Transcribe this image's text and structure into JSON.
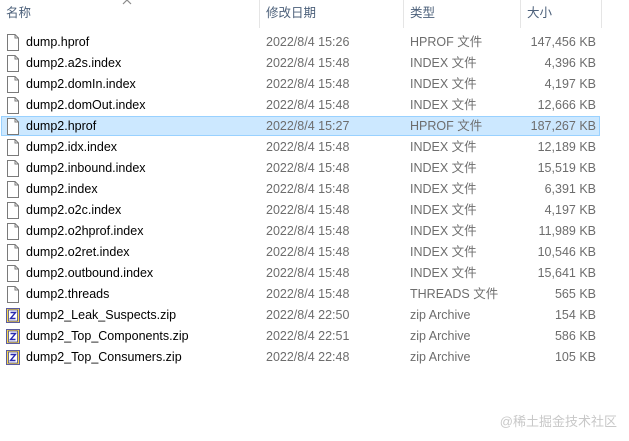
{
  "columns": {
    "name": "名称",
    "date": "修改日期",
    "type": "类型",
    "size": "大小"
  },
  "files": [
    {
      "name": "dump.hprof",
      "date": "2022/8/4 15:26",
      "type": "HPROF 文件",
      "size": "147,456 KB",
      "icon": "file-icon",
      "selected": false
    },
    {
      "name": "dump2.a2s.index",
      "date": "2022/8/4 15:48",
      "type": "INDEX 文件",
      "size": "4,396 KB",
      "icon": "file-icon",
      "selected": false
    },
    {
      "name": "dump2.domIn.index",
      "date": "2022/8/4 15:48",
      "type": "INDEX 文件",
      "size": "4,197 KB",
      "icon": "file-icon",
      "selected": false
    },
    {
      "name": "dump2.domOut.index",
      "date": "2022/8/4 15:48",
      "type": "INDEX 文件",
      "size": "12,666 KB",
      "icon": "file-icon",
      "selected": false
    },
    {
      "name": "dump2.hprof",
      "date": "2022/8/4 15:27",
      "type": "HPROF 文件",
      "size": "187,267 KB",
      "icon": "file-icon",
      "selected": true
    },
    {
      "name": "dump2.idx.index",
      "date": "2022/8/4 15:48",
      "type": "INDEX 文件",
      "size": "12,189 KB",
      "icon": "file-icon",
      "selected": false
    },
    {
      "name": "dump2.inbound.index",
      "date": "2022/8/4 15:48",
      "type": "INDEX 文件",
      "size": "15,519 KB",
      "icon": "file-icon",
      "selected": false
    },
    {
      "name": "dump2.index",
      "date": "2022/8/4 15:48",
      "type": "INDEX 文件",
      "size": "6,391 KB",
      "icon": "file-icon",
      "selected": false
    },
    {
      "name": "dump2.o2c.index",
      "date": "2022/8/4 15:48",
      "type": "INDEX 文件",
      "size": "4,197 KB",
      "icon": "file-icon",
      "selected": false
    },
    {
      "name": "dump2.o2hprof.index",
      "date": "2022/8/4 15:48",
      "type": "INDEX 文件",
      "size": "11,989 KB",
      "icon": "file-icon",
      "selected": false
    },
    {
      "name": "dump2.o2ret.index",
      "date": "2022/8/4 15:48",
      "type": "INDEX 文件",
      "size": "10,546 KB",
      "icon": "file-icon",
      "selected": false
    },
    {
      "name": "dump2.outbound.index",
      "date": "2022/8/4 15:48",
      "type": "INDEX 文件",
      "size": "15,641 KB",
      "icon": "file-icon",
      "selected": false
    },
    {
      "name": "dump2.threads",
      "date": "2022/8/4 15:48",
      "type": "THREADS 文件",
      "size": "565 KB",
      "icon": "file-icon",
      "selected": false
    },
    {
      "name": "dump2_Leak_Suspects.zip",
      "date": "2022/8/4 22:50",
      "type": "zip Archive",
      "size": "154 KB",
      "icon": "zip-archive-icon",
      "selected": false
    },
    {
      "name": "dump2_Top_Components.zip",
      "date": "2022/8/4 22:51",
      "type": "zip Archive",
      "size": "586 KB",
      "icon": "zip-archive-icon",
      "selected": false
    },
    {
      "name": "dump2_Top_Consumers.zip",
      "date": "2022/8/4 22:48",
      "type": "zip Archive",
      "size": "105 KB",
      "icon": "zip-archive-icon",
      "selected": false
    }
  ],
  "watermark": "@稀土掘金技术社区",
  "colors": {
    "selection_bg": "#cce8ff",
    "selection_border": "#99d1ff",
    "header_text": "#4c607a",
    "meta_text": "#6d6d6d"
  }
}
